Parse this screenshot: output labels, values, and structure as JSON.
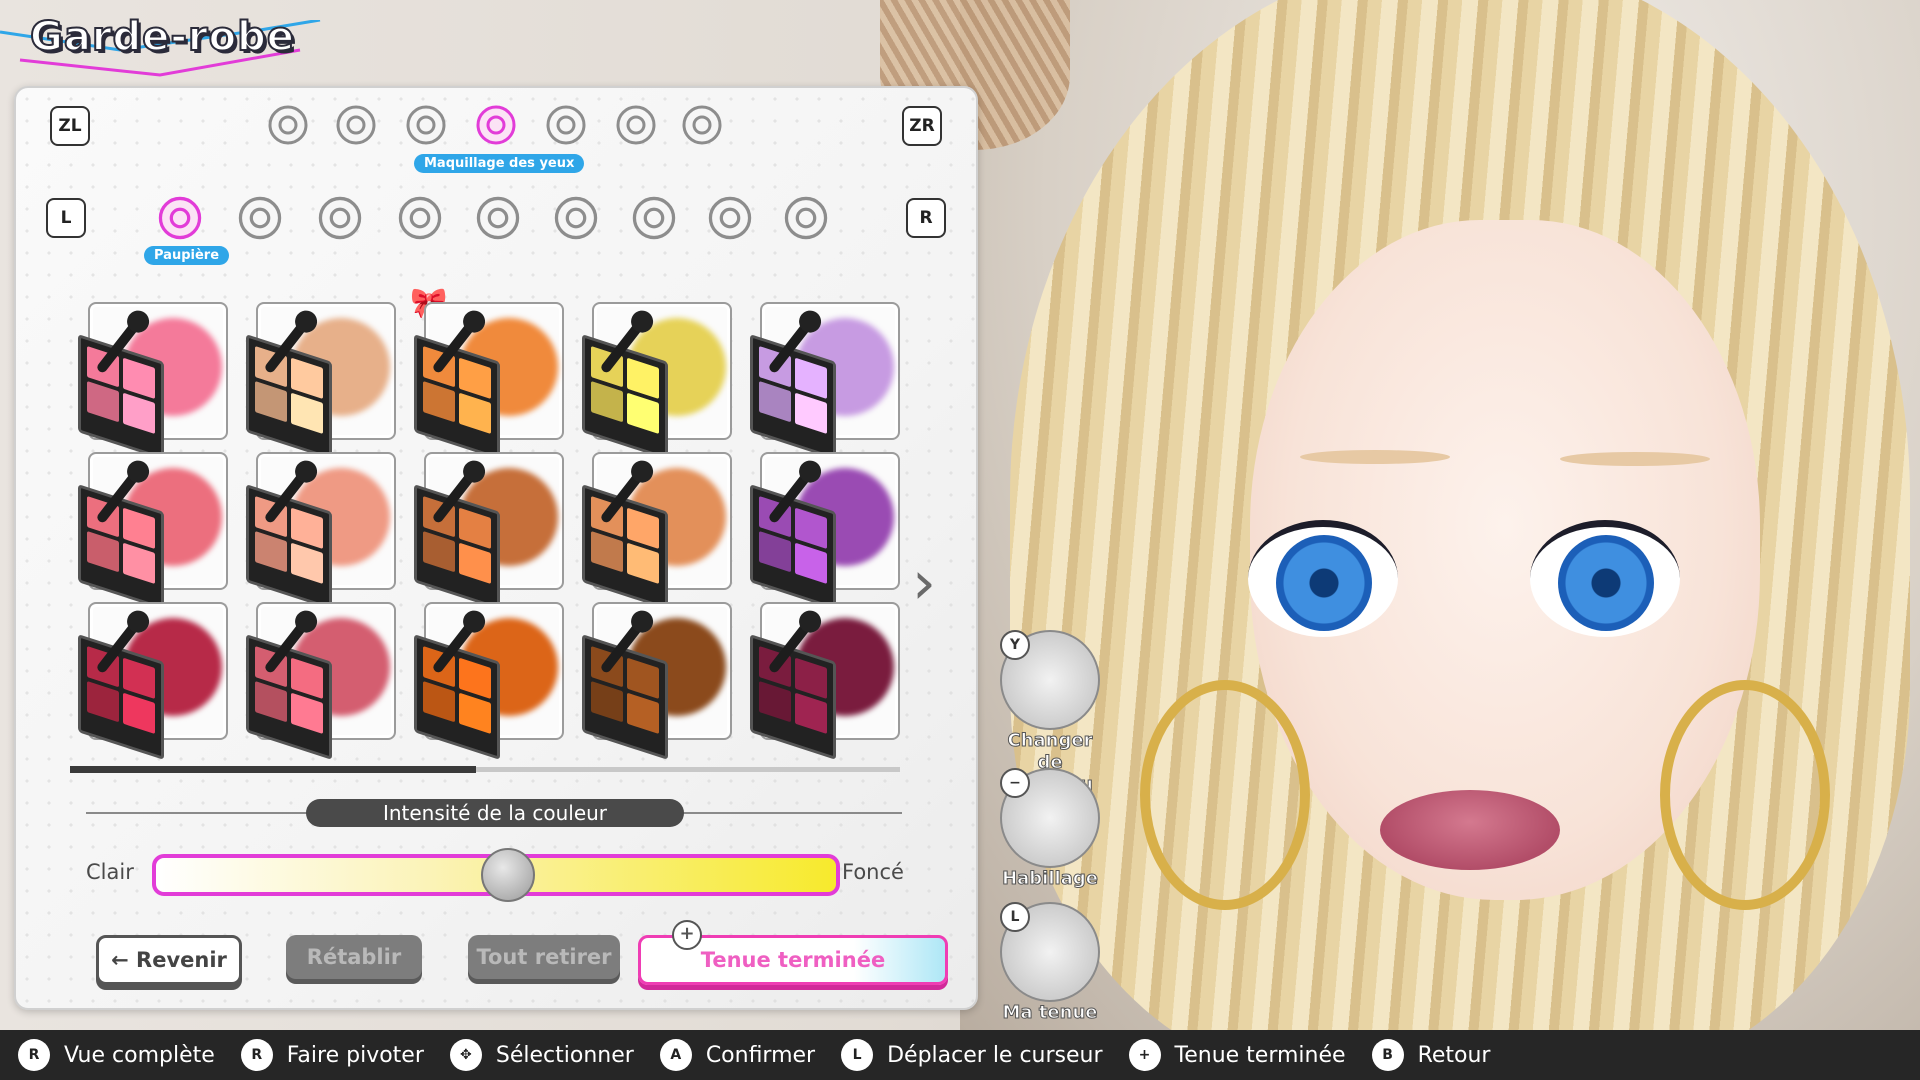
{
  "title": "Garde-robe",
  "keys": {
    "zl": "ZL",
    "zr": "ZR",
    "l": "L",
    "r": "R"
  },
  "categories": [
    {
      "icon": "face-icon"
    },
    {
      "icon": "hair-icon"
    },
    {
      "icon": "eye-icon"
    },
    {
      "icon": "eyeshadow-palette-icon",
      "label": "Maquillage des yeux",
      "selected": true
    },
    {
      "icon": "blush-compact-icon"
    },
    {
      "icon": "lipstick-icon"
    },
    {
      "icon": "nail-polish-icon"
    }
  ],
  "subcategories": [
    {
      "icon": "eyelid-icon",
      "label": "Paupière",
      "selected": true
    },
    {
      "icon": "eyeliner-icon"
    },
    {
      "icon": "eyelash-icon"
    },
    {
      "icon": "eye-sparkle-icon"
    },
    {
      "icon": "eye-highlight-icon"
    },
    {
      "icon": "under-eye-icon"
    },
    {
      "icon": "eye-decoration-icon"
    },
    {
      "icon": "brush-icon"
    },
    {
      "icon": "pencil-icon"
    }
  ],
  "swatches": [
    [
      "#f47a9a",
      "#e7b08a",
      "#f08a3c",
      "#e6d258",
      "#c79be2"
    ],
    [
      "#ec6f7e",
      "#ef9a84",
      "#c66f3a",
      "#e3905a",
      "#9a4bb3"
    ],
    [
      "#b72a48",
      "#d45e70",
      "#dc6518",
      "#8b4a1c",
      "#7a1c3e"
    ]
  ],
  "intensity": {
    "label": "Intensité de la couleur",
    "min_label": "Clair",
    "max_label": "Foncé",
    "value": 0.52
  },
  "buttons": {
    "back": "Revenir",
    "reset": "Rétablir",
    "remove_all": "Tout retirer",
    "done": "Tenue terminée"
  },
  "actions": [
    {
      "key": "Y",
      "label": "Changer de chapeau"
    },
    {
      "key": "−",
      "label": "Habillage"
    },
    {
      "key": "L",
      "label": "Ma tenue"
    }
  ],
  "bottom_hints": [
    {
      "button": "R",
      "label": "Vue complète"
    },
    {
      "button": "R",
      "label": "Faire pivoter"
    },
    {
      "button": "✥",
      "label": "Sélectionner"
    },
    {
      "button": "A",
      "label": "Confirmer"
    },
    {
      "button": "L",
      "label": "Déplacer le curseur"
    },
    {
      "button": "+",
      "label": "Tenue terminée"
    },
    {
      "button": "B",
      "label": "Retour"
    }
  ]
}
